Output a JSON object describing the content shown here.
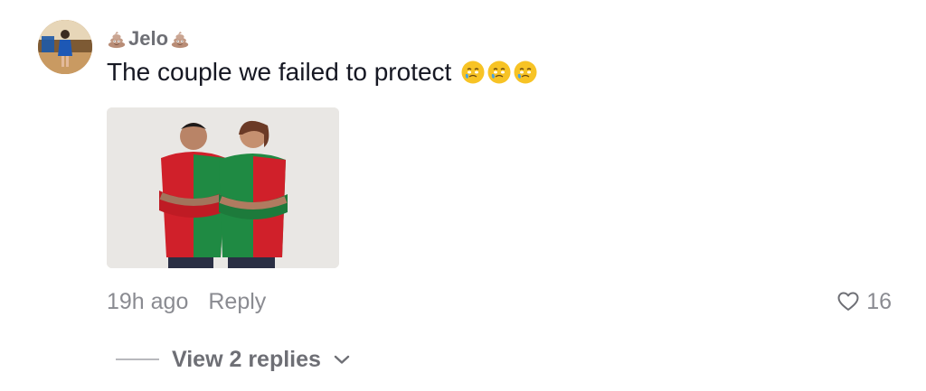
{
  "comment": {
    "username": "Jelo",
    "username_emoji": "poop-emoji",
    "text": "The couple we failed to protect",
    "text_emojis": [
      "face-holding-back-tears",
      "face-holding-back-tears",
      "face-holding-back-tears"
    ],
    "time": "19h ago",
    "reply_label": "Reply",
    "like_count": "16",
    "view_replies_label": "View 2 replies"
  },
  "colors": {
    "primary_text": "#161823",
    "secondary_text": "#8a8b91",
    "username": "#6e6f75",
    "shirt_red": "#d0202a",
    "shirt_green": "#1f8a43"
  },
  "icons": {
    "like": "heart-outline-icon",
    "expand": "chevron-down-icon"
  }
}
